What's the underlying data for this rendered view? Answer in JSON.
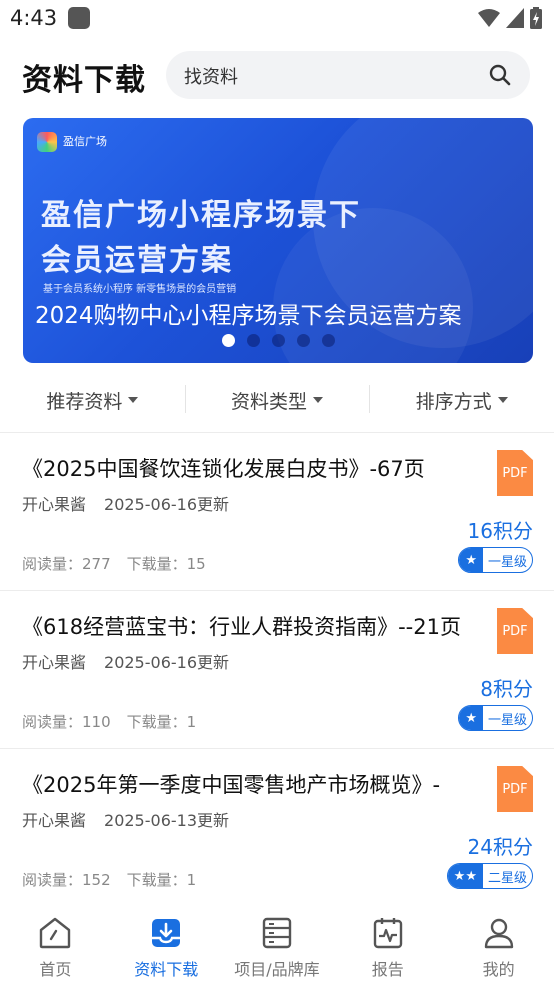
{
  "status_bar": {
    "time": "4:43"
  },
  "header": {
    "title": "资料下载",
    "search_placeholder": "找资料"
  },
  "banner": {
    "logo_text": "盈信广场",
    "headline_1": "盈信广场小程序场景下",
    "headline_2": "会员运营方案",
    "small_text": "基于会员系统小程序 新零售场景的会员营销",
    "caption": "2024购物中心小程序场景下会员运营方案",
    "dot_count": 5,
    "active_dot": 0
  },
  "filters": [
    {
      "label": "推荐资料"
    },
    {
      "label": "资料类型"
    },
    {
      "label": "排序方式"
    }
  ],
  "documents": [
    {
      "title": "《2025中国餐饮连锁化发展白皮书》-67页",
      "author": "开心果酱",
      "updated": "2025-06-16更新",
      "file_type": "PDF",
      "points": "16积分",
      "reads_label": "阅读量：277",
      "downloads_label": "下载量：15",
      "level": "一星级",
      "stars": 1
    },
    {
      "title": "《618经营蓝宝书：行业人群投资指南》--21页",
      "author": "开心果酱",
      "updated": "2025-06-16更新",
      "file_type": "PDF",
      "points": "8积分",
      "reads_label": "阅读量：110",
      "downloads_label": "下载量：1",
      "level": "一星级",
      "stars": 1
    },
    {
      "title": "《2025年第一季度中国零售地产市场概览》-",
      "author": "开心果酱",
      "updated": "2025-06-13更新",
      "file_type": "PDF",
      "points": "24积分",
      "reads_label": "阅读量：152",
      "downloads_label": "下载量：1",
      "level": "二星级",
      "stars": 2
    }
  ],
  "tabbar": [
    {
      "label": "首页",
      "icon": "home-icon"
    },
    {
      "label": "资料下载",
      "icon": "download-tray-icon",
      "active": true
    },
    {
      "label": "项目/品牌库",
      "icon": "database-icon"
    },
    {
      "label": "报告",
      "icon": "report-icon"
    },
    {
      "label": "我的",
      "icon": "user-icon"
    }
  ],
  "colors": {
    "accent": "#1a6fe0",
    "pdf": "#fb8a43",
    "banner": "#2c6cf0"
  }
}
